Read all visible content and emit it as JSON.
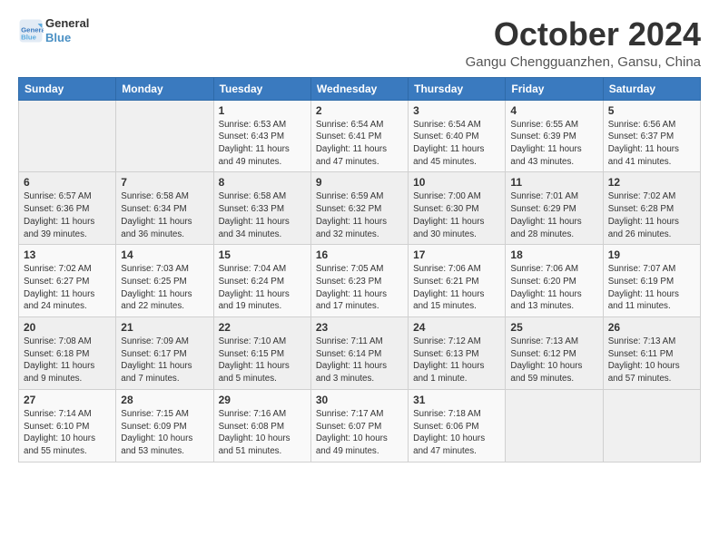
{
  "logo": {
    "line1": "General",
    "line2": "Blue"
  },
  "title": "October 2024",
  "location": "Gangu Chengguanzhen, Gansu, China",
  "days_of_week": [
    "Sunday",
    "Monday",
    "Tuesday",
    "Wednesday",
    "Thursday",
    "Friday",
    "Saturday"
  ],
  "weeks": [
    [
      {
        "day": "",
        "info": ""
      },
      {
        "day": "",
        "info": ""
      },
      {
        "day": "1",
        "info": "Sunrise: 6:53 AM\nSunset: 6:43 PM\nDaylight: 11 hours and 49 minutes."
      },
      {
        "day": "2",
        "info": "Sunrise: 6:54 AM\nSunset: 6:41 PM\nDaylight: 11 hours and 47 minutes."
      },
      {
        "day": "3",
        "info": "Sunrise: 6:54 AM\nSunset: 6:40 PM\nDaylight: 11 hours and 45 minutes."
      },
      {
        "day": "4",
        "info": "Sunrise: 6:55 AM\nSunset: 6:39 PM\nDaylight: 11 hours and 43 minutes."
      },
      {
        "day": "5",
        "info": "Sunrise: 6:56 AM\nSunset: 6:37 PM\nDaylight: 11 hours and 41 minutes."
      }
    ],
    [
      {
        "day": "6",
        "info": "Sunrise: 6:57 AM\nSunset: 6:36 PM\nDaylight: 11 hours and 39 minutes."
      },
      {
        "day": "7",
        "info": "Sunrise: 6:58 AM\nSunset: 6:34 PM\nDaylight: 11 hours and 36 minutes."
      },
      {
        "day": "8",
        "info": "Sunrise: 6:58 AM\nSunset: 6:33 PM\nDaylight: 11 hours and 34 minutes."
      },
      {
        "day": "9",
        "info": "Sunrise: 6:59 AM\nSunset: 6:32 PM\nDaylight: 11 hours and 32 minutes."
      },
      {
        "day": "10",
        "info": "Sunrise: 7:00 AM\nSunset: 6:30 PM\nDaylight: 11 hours and 30 minutes."
      },
      {
        "day": "11",
        "info": "Sunrise: 7:01 AM\nSunset: 6:29 PM\nDaylight: 11 hours and 28 minutes."
      },
      {
        "day": "12",
        "info": "Sunrise: 7:02 AM\nSunset: 6:28 PM\nDaylight: 11 hours and 26 minutes."
      }
    ],
    [
      {
        "day": "13",
        "info": "Sunrise: 7:02 AM\nSunset: 6:27 PM\nDaylight: 11 hours and 24 minutes."
      },
      {
        "day": "14",
        "info": "Sunrise: 7:03 AM\nSunset: 6:25 PM\nDaylight: 11 hours and 22 minutes."
      },
      {
        "day": "15",
        "info": "Sunrise: 7:04 AM\nSunset: 6:24 PM\nDaylight: 11 hours and 19 minutes."
      },
      {
        "day": "16",
        "info": "Sunrise: 7:05 AM\nSunset: 6:23 PM\nDaylight: 11 hours and 17 minutes."
      },
      {
        "day": "17",
        "info": "Sunrise: 7:06 AM\nSunset: 6:21 PM\nDaylight: 11 hours and 15 minutes."
      },
      {
        "day": "18",
        "info": "Sunrise: 7:06 AM\nSunset: 6:20 PM\nDaylight: 11 hours and 13 minutes."
      },
      {
        "day": "19",
        "info": "Sunrise: 7:07 AM\nSunset: 6:19 PM\nDaylight: 11 hours and 11 minutes."
      }
    ],
    [
      {
        "day": "20",
        "info": "Sunrise: 7:08 AM\nSunset: 6:18 PM\nDaylight: 11 hours and 9 minutes."
      },
      {
        "day": "21",
        "info": "Sunrise: 7:09 AM\nSunset: 6:17 PM\nDaylight: 11 hours and 7 minutes."
      },
      {
        "day": "22",
        "info": "Sunrise: 7:10 AM\nSunset: 6:15 PM\nDaylight: 11 hours and 5 minutes."
      },
      {
        "day": "23",
        "info": "Sunrise: 7:11 AM\nSunset: 6:14 PM\nDaylight: 11 hours and 3 minutes."
      },
      {
        "day": "24",
        "info": "Sunrise: 7:12 AM\nSunset: 6:13 PM\nDaylight: 11 hours and 1 minute."
      },
      {
        "day": "25",
        "info": "Sunrise: 7:13 AM\nSunset: 6:12 PM\nDaylight: 10 hours and 59 minutes."
      },
      {
        "day": "26",
        "info": "Sunrise: 7:13 AM\nSunset: 6:11 PM\nDaylight: 10 hours and 57 minutes."
      }
    ],
    [
      {
        "day": "27",
        "info": "Sunrise: 7:14 AM\nSunset: 6:10 PM\nDaylight: 10 hours and 55 minutes."
      },
      {
        "day": "28",
        "info": "Sunrise: 7:15 AM\nSunset: 6:09 PM\nDaylight: 10 hours and 53 minutes."
      },
      {
        "day": "29",
        "info": "Sunrise: 7:16 AM\nSunset: 6:08 PM\nDaylight: 10 hours and 51 minutes."
      },
      {
        "day": "30",
        "info": "Sunrise: 7:17 AM\nSunset: 6:07 PM\nDaylight: 10 hours and 49 minutes."
      },
      {
        "day": "31",
        "info": "Sunrise: 7:18 AM\nSunset: 6:06 PM\nDaylight: 10 hours and 47 minutes."
      },
      {
        "day": "",
        "info": ""
      },
      {
        "day": "",
        "info": ""
      }
    ]
  ]
}
